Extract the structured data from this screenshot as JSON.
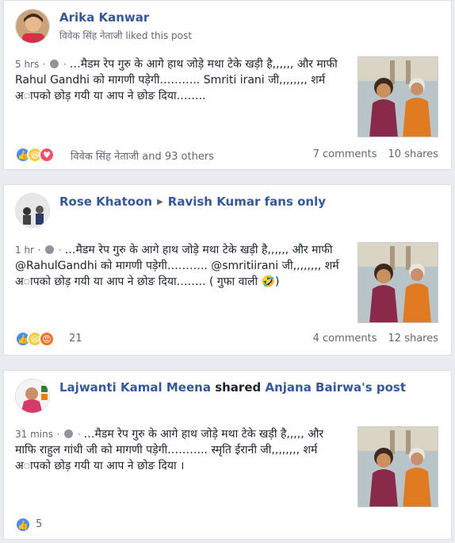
{
  "posts": [
    {
      "author": "Arika Kanwar",
      "activity_actor": "विवेक सिंह नेताजी",
      "activity_text": "liked this post",
      "time": "5 hrs",
      "text": "…मैडम रेप गुरु के आगे हाथ जोड़े मथा टेके खड़ी है,,,,,, और माफी Rahul Gandhi को मागणी पड़ेगी……….. Smriti irani जी,,,,,,,, शर्म अापको छोड़ गयी या आप ने छोङ दिया……..",
      "reactions_label": "विवेक सिंह नेताजी and 93 others",
      "comments": "7 comments",
      "shares": "10 shares"
    },
    {
      "author": "Rose Khatoon",
      "group": "Ravish Kumar fans only",
      "time": "1 hr",
      "text": "…मैडम रेप गुरु के आगे हाथ जोड़े मथा टेके खड़ी है,,,,,, और माफी @RahulGandhi को मागणी पड़ेगी……….. @smritiirani जी,,,,,,,, शर्म अापको छोड़ गयी या आप ने छोङ दिया…….. ( गुफा वाली 🤣)",
      "reactions_label": "21",
      "comments": "4 comments",
      "shares": "12 shares"
    },
    {
      "author": "Lajwanti Kamal Meena",
      "shared_word": "shared",
      "shared_from": "Anjana Bairwa's post",
      "time": "31 mins",
      "text": "…मैडम रेप गुरु के आगे हाथ जोड़े मथा टेके खड़ी है,,,,, और माफि राहुल गांधी जी को मागणी पड़ेगी……….. स्मृति ईरानी जी,,,,,,,, शर्म अापको छोड़ गयी या आप ने छोङ दिया ।",
      "reactions_label": "5"
    }
  ],
  "icons": [
    "like-icon",
    "haha-icon",
    "love-icon",
    "angry-icon",
    "globe-icon",
    "arrow-right-icon"
  ],
  "colors": {
    "link": "#365899",
    "like": "#4e8cf2",
    "haha": "#f7c845",
    "love": "#f25268",
    "angry": "#f0702c",
    "bg": "#e9ebee"
  }
}
